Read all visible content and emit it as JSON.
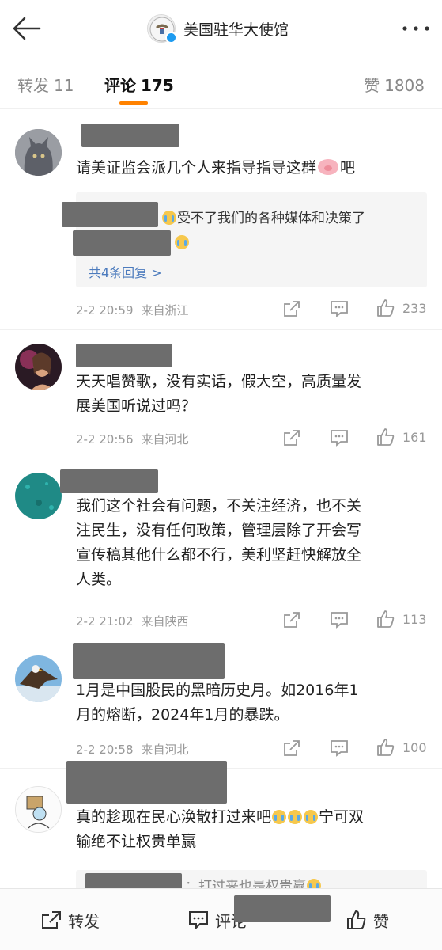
{
  "header": {
    "title": "美国驻华大使馆",
    "back_icon": "arrow-left-icon",
    "more_icon": "more-dots-icon",
    "seal_icon": "eagle-seal-icon",
    "verified_color": "#1d9bf0"
  },
  "tabs": [
    {
      "label": "转发",
      "count": "11"
    },
    {
      "label": "评论",
      "count": "175"
    },
    {
      "label": "赞",
      "count": "1808"
    }
  ],
  "accent_color": "#ff8200",
  "comments": [
    {
      "text": "请美证监会派几个人来指导指导这群🐷吧",
      "text_before": "请美证监会派几个人来指导指导这群",
      "text_after": "吧",
      "replies": [
        {
          "text": "受不了我们的各种媒体和决策了"
        },
        {
          "text": ""
        }
      ],
      "more_replies": "共4条回复 >",
      "time": "2-2 20:59",
      "location": "来自浙江",
      "likes": "233"
    },
    {
      "text_line1": "天天唱赞歌，没有实话，假大空，高质量发",
      "text_line2": "展美国听说过吗？",
      "time": "2-2 20:56",
      "location": "来自河北",
      "likes": "161"
    },
    {
      "text_line1": "我们这个社会有问题，不关注经济，也不关",
      "text_line2": "注民生，没有任何政策，管理层除了开会写",
      "text_line3": "宣传稿其他什么都不行，美利坚赶快解放全",
      "text_line4": "人类。",
      "time": "2-2 21:02",
      "location": "来自陕西",
      "likes": "113"
    },
    {
      "text_line1": "1月是中国股民的黑暗历史月。如2016年1",
      "text_line2": "月的熔断，2024年1月的暴跌。",
      "time": "2-2 20:58",
      "location": "来自河北",
      "likes": "100"
    },
    {
      "text_line1_before": "真的趁现在民心涣散打过来吧",
      "text_line1_after": "宁可双",
      "text_line2": "输绝不让权贵单赢",
      "reply_preview": "：打过来也是权贵赢"
    }
  ],
  "actions": {
    "share_icon": "share-icon",
    "comment_icon": "comment-icon",
    "like_icon": "thumbs-up-icon"
  },
  "bottom_bar": {
    "repost": "转发",
    "comment": "评论",
    "like": "赞"
  }
}
